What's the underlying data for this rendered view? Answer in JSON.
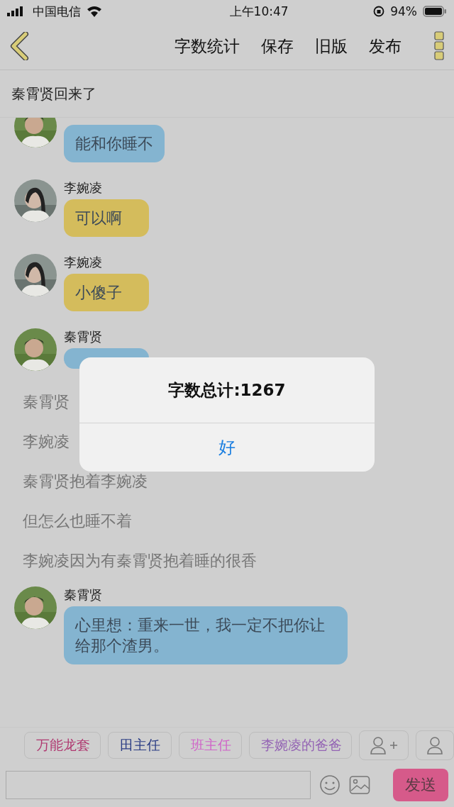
{
  "status_bar": {
    "carrier": "中国电信",
    "time": "上午10:47",
    "battery": "94%"
  },
  "toolbar": {
    "actions": [
      "字数统计",
      "保存",
      "旧版",
      "发布"
    ]
  },
  "chapter_title": "秦霄贤回来了",
  "messages": [
    {
      "kind": "bubble",
      "female": false,
      "text": "能和你睡不",
      "color": "#84b4d0"
    },
    {
      "kind": "bubble",
      "female": true,
      "name": "李婉凌",
      "text": "可以啊",
      "color": "#d4bc5c"
    },
    {
      "kind": "bubble",
      "female": true,
      "name": "李婉凌",
      "text": "小傻子",
      "color": "#d4bc5c"
    },
    {
      "kind": "bubble",
      "female": false,
      "name": "秦霄贤",
      "color": "#84b4d0"
    },
    {
      "kind": "narration",
      "text": "秦霄贤"
    },
    {
      "kind": "narration",
      "text": "李婉凌"
    },
    {
      "kind": "narration",
      "text": "秦霄贤抱着李婉凌"
    },
    {
      "kind": "narration",
      "text": "但怎么也睡不着"
    },
    {
      "kind": "narration",
      "text": "李婉凌因为有秦霄贤抱着睡的很香"
    },
    {
      "kind": "bubble",
      "female": false,
      "name": "秦霄贤",
      "text": "心里想：重来一世，我一定不把你让给那个渣男。",
      "color": "#84b4d0"
    }
  ],
  "roles": [
    {
      "name": "万能龙套",
      "color": "#b03870"
    },
    {
      "name": "田主任",
      "color": "#2a3c84"
    },
    {
      "name": "班主任",
      "color": "#d064c8"
    },
    {
      "name": "李婉凌的爸爸",
      "color": "#9464b4"
    }
  ],
  "send_button": "发送",
  "alert": {
    "title": "字数总计:1267",
    "button": "好"
  }
}
